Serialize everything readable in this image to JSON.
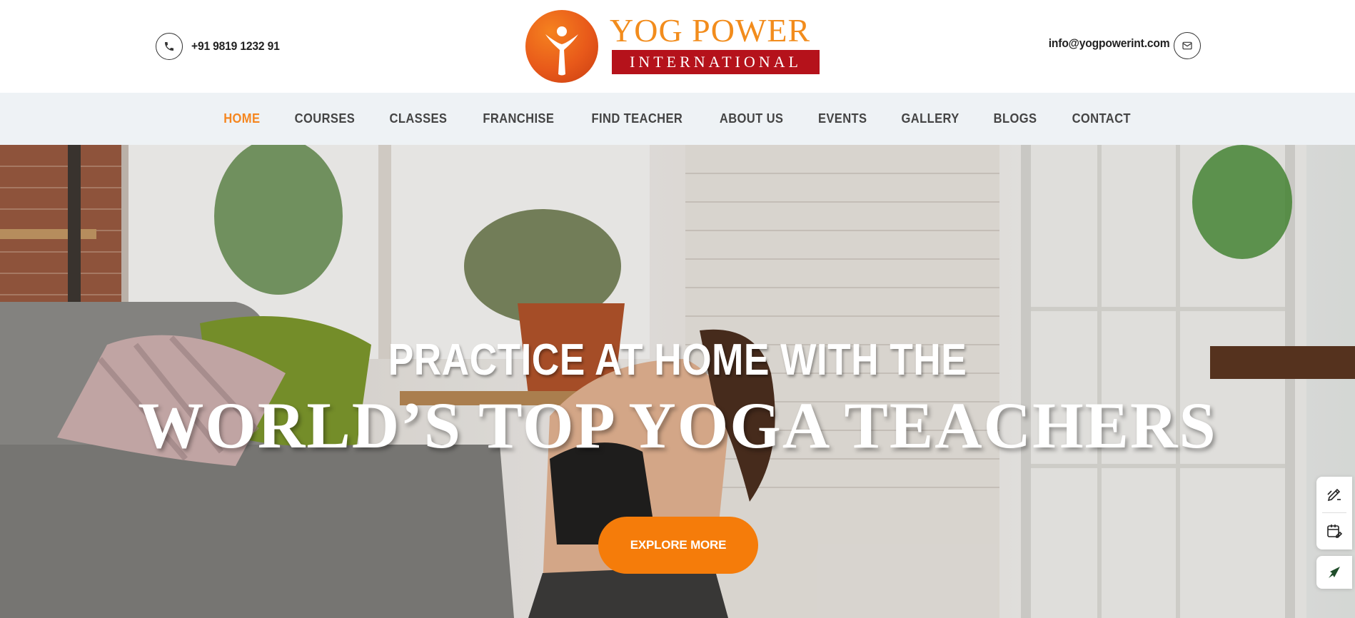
{
  "header": {
    "phone": "+91 9819 1232 91",
    "email": "info@yogpowerint.com",
    "logo": {
      "word": "YOG POWER",
      "band": "INTERNATIONAL",
      "color_word": "#f28c1c",
      "color_band": "#b5121b"
    }
  },
  "nav": {
    "items": [
      {
        "label": "HOME",
        "active": true
      },
      {
        "label": "COURSES"
      },
      {
        "label": "CLASSES"
      },
      {
        "label": "FRANCHISE"
      },
      {
        "label": "FIND TEACHER"
      },
      {
        "label": "ABOUT US"
      },
      {
        "label": "EVENTS"
      },
      {
        "label": "GALLERY"
      },
      {
        "label": "BLOGS"
      },
      {
        "label": "CONTACT"
      }
    ],
    "active_color": "#f5861f"
  },
  "hero": {
    "line1": "PRACTICE AT HOME WITH THE",
    "line2": "WORLD’S TOP YOGA TEACHERS",
    "button_label": "EXPLORE MORE",
    "button_color": "#f57c0a"
  },
  "side_widgets": {
    "icons": [
      "edit-pen-icon",
      "calendar-edit-icon",
      "arrow-rocket-icon"
    ]
  }
}
